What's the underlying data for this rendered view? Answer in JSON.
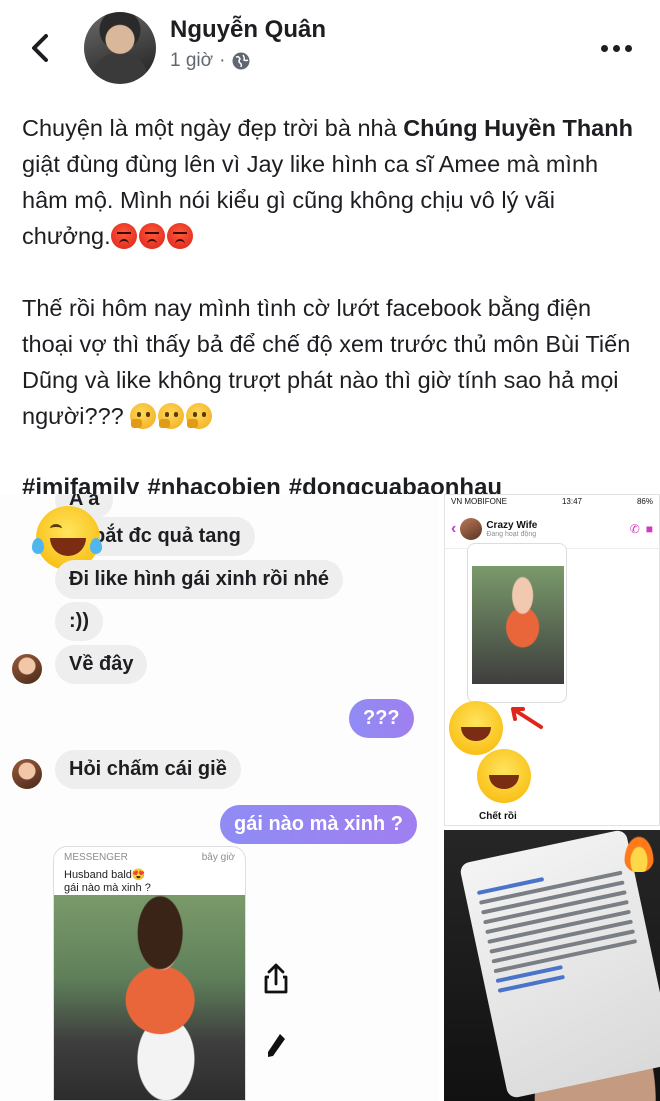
{
  "header": {
    "author_name": "Nguyễn Quân",
    "timestamp": "1 giờ",
    "separator": "·",
    "privacy_icon": "globe-icon",
    "back_icon": "chevron-left-icon",
    "more_icon": "more-horizontal-icon"
  },
  "post": {
    "para1_part1": "Chuyện là một ngày đẹp trời bà nhà ",
    "para1_bold": "Chúng Huyền Thanh",
    "para1_part2": " giật đùng đùng lên vì Jay like hình ca sĩ Amee mà mình hâm mộ. Mình nói kiểu gì cũng không chịu vô lý vãi chưởng.",
    "para1_emojis": [
      "angry-face",
      "angry-face",
      "angry-face"
    ],
    "para2": "Thế rồi hôm nay mình tình cờ lướt facebook bằng điện thoại vợ thì thấy bả để chế độ xem trước thủ môn Bùi Tiến Dũng và like không trượt phát nào thì giờ tính sao hả mọi người???",
    "para2_emojis": [
      "thinking-face",
      "thinking-face",
      "thinking-face"
    ],
    "hashtags": [
      "#jmjfamily",
      "#nhacobien",
      "#dongcuabaonhau"
    ]
  },
  "chat": {
    "top_fragment": "A a",
    "messages": [
      {
        "side": "in",
        "text": "bắt đc quả tang"
      },
      {
        "side": "in",
        "text": "Đi like hình gái xinh rồi nhé"
      },
      {
        "side": "in",
        "text": ":))"
      },
      {
        "side": "in",
        "text": "Về đây"
      },
      {
        "side": "out",
        "text": "???"
      },
      {
        "side": "in",
        "text": "Hỏi chấm cái giề"
      },
      {
        "side": "out",
        "text": "gái nào mà xinh ?"
      }
    ],
    "preview": {
      "app": "MESSENGER",
      "time": "bây giờ",
      "title": "Husband bald😍",
      "text": "gái nào mà xinh ?"
    }
  },
  "messenger_screen": {
    "carrier": "VN MOBIFONE",
    "time": "13:47",
    "battery": "86%",
    "contact_name": "Crazy Wife",
    "contact_status": "Đang hoạt động",
    "footer_text": "Chết rồi"
  },
  "colors": {
    "text": "#1c1e21",
    "meta": "#606770",
    "bubble_out_start": "#8f8cf4",
    "bubble_out_end": "#a07ff0",
    "bubble_in": "#eeeeee"
  }
}
